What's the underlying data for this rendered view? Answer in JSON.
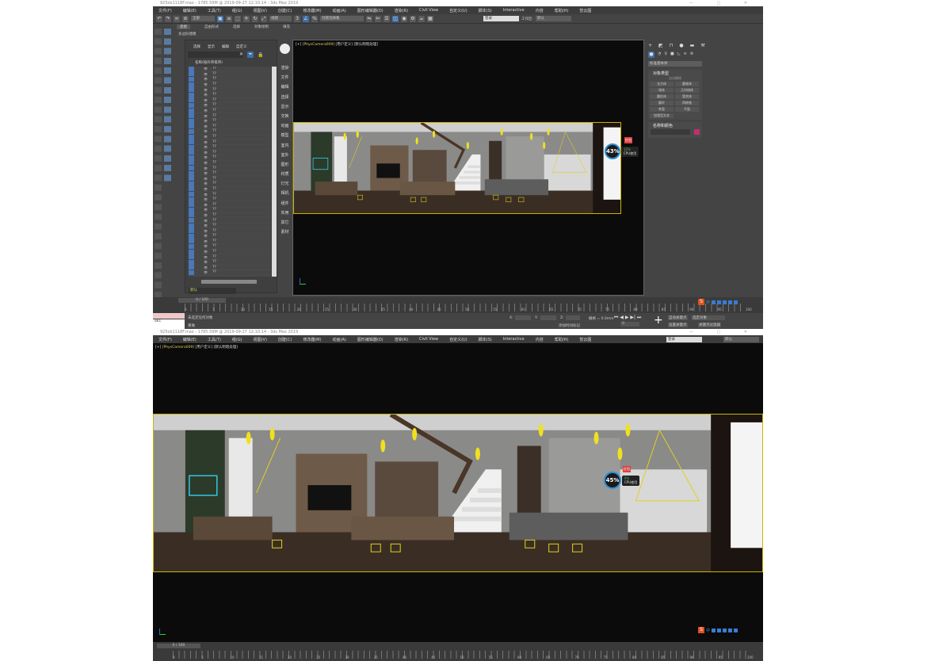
{
  "window": {
    "title": "925ok1118F.max - 1785.59M @ 2019-09-27 12:10:14 - 3ds Max 2019",
    "controls": "— ▢ ✕"
  },
  "menu": [
    "文件(F)",
    "编辑(E)",
    "工具(T)",
    "组(G)",
    "视图(V)",
    "创建(C)",
    "修改器(M)",
    "动画(A)",
    "图形编辑器(D)",
    "渲染(R)",
    "Civil View",
    "自定义(U)",
    "脚本(S)",
    "Interactive",
    "内容",
    "帮助(H)",
    "暂云图"
  ],
  "toolbar": {
    "selection_filter": "全部",
    "ref_coord": "视图",
    "named_selection": "创建选择集",
    "user": "登录",
    "workspace_label": "工作区:",
    "workspace": "默认"
  },
  "ribbon": {
    "tabs": [
      "建模",
      "自由形式",
      "选择",
      "对象绘制",
      "填充"
    ],
    "sub": "多边形建模"
  },
  "explorer": {
    "tabs": [
      "选择",
      "显示",
      "编辑",
      "自定义"
    ],
    "column_header": "名称(按升序排序)",
    "rows": [
      "??",
      "??",
      "??",
      "??",
      "??",
      "??",
      "??",
      "??",
      "??",
      "??",
      "??",
      "??",
      "??",
      "??",
      "??",
      "??",
      "??",
      "??",
      "??",
      "??",
      "??",
      "??",
      "??",
      "??",
      "??",
      "??",
      "??",
      "??",
      "??",
      "??",
      "??",
      "??",
      "??",
      "??",
      "??",
      "??",
      "??",
      "??",
      "??",
      "??"
    ],
    "layer": "默认"
  },
  "side_menu": [
    "渲染",
    "文件",
    "编辑",
    "选择",
    "显示",
    "交换",
    "动画",
    "模型",
    "室内",
    "室外",
    "图形",
    "材质",
    "灯光",
    "相机",
    "组件",
    "实用",
    "其它",
    "素材"
  ],
  "viewport": {
    "plus": "[+]",
    "camera": "[PhysCamera009]",
    "mode": "[用户定义]",
    "shading": "[默认明暗处理]"
  },
  "command_panel": {
    "dropdown": "标准基本体",
    "rollout_object_type": "对象类型",
    "autogrid": "自动栅格",
    "buttons": [
      "长方体",
      "圆锥体",
      "球体",
      "几何球体",
      "圆柱体",
      "管状体",
      "圆环",
      "四棱锥",
      "茶壶",
      "平面",
      "加强型文本"
    ],
    "rollout_name_color": "名称和颜色",
    "object_color": "#c0306a"
  },
  "monitor_top": {
    "cpu_percent": "43%",
    "mem_percent": "10%",
    "cpu_label": "CPU使用",
    "badge": "红包"
  },
  "monitor_bottom": {
    "cpu_percent": "45%",
    "mem_percent": "6%",
    "cpu_label": "CPU使用",
    "badge": "红包"
  },
  "timeline": {
    "frame": "0 / 100",
    "ticks": [
      "0",
      "5",
      "10",
      "15",
      "20",
      "25",
      "30",
      "35",
      "40",
      "45",
      "50",
      "55",
      "60",
      "65",
      "70",
      "75",
      "80",
      "85",
      "90",
      "95",
      "100"
    ]
  },
  "status": {
    "selected": "未选定任何对象",
    "hint": "重做",
    "script_value": "ok1",
    "x_label": "X:",
    "y_label": "Y:",
    "z_label": "Z:",
    "grid": "栅格 = 0.0mm",
    "add_time_tag": "添加时间标记",
    "auto_key": "自动关键点",
    "set_key": "设置关键点",
    "key_filter": "关键点过滤器",
    "selected_obj": "选定对象",
    "frame_value": "0"
  },
  "ime": {
    "logo": "S",
    "mode": "中"
  }
}
